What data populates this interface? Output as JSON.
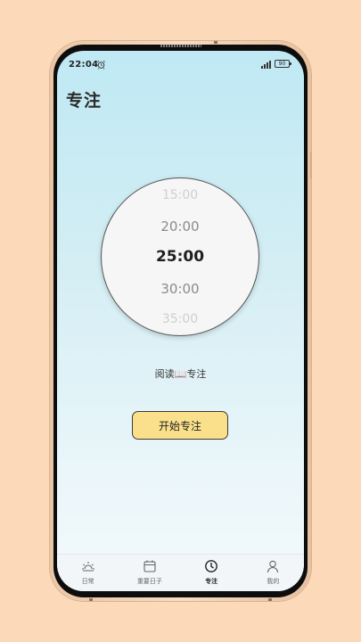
{
  "status_bar": {
    "time": "22:04",
    "battery": "90",
    "icons": [
      "alarm-icon",
      "signal-icon",
      "battery-icon"
    ]
  },
  "page": {
    "title": "专注"
  },
  "picker": {
    "options": [
      "15:00",
      "20:00",
      "25:00",
      "30:00",
      "35:00"
    ],
    "selected": "25:00"
  },
  "task_label": "阅读📖专注",
  "start_button_label": "开始专注",
  "nav": {
    "items": [
      {
        "label": "日常",
        "icon": "sun-icon"
      },
      {
        "label": "重要日子",
        "icon": "calendar-icon"
      },
      {
        "label": "专注",
        "icon": "clock-icon",
        "active": true
      },
      {
        "label": "我的",
        "icon": "user-icon"
      }
    ]
  },
  "colors": {
    "page_background": "#fcd9b9",
    "screen_gradient_top": "#bfe9f4",
    "button_fill": "#fbe08c",
    "active_nav": "#222222"
  }
}
